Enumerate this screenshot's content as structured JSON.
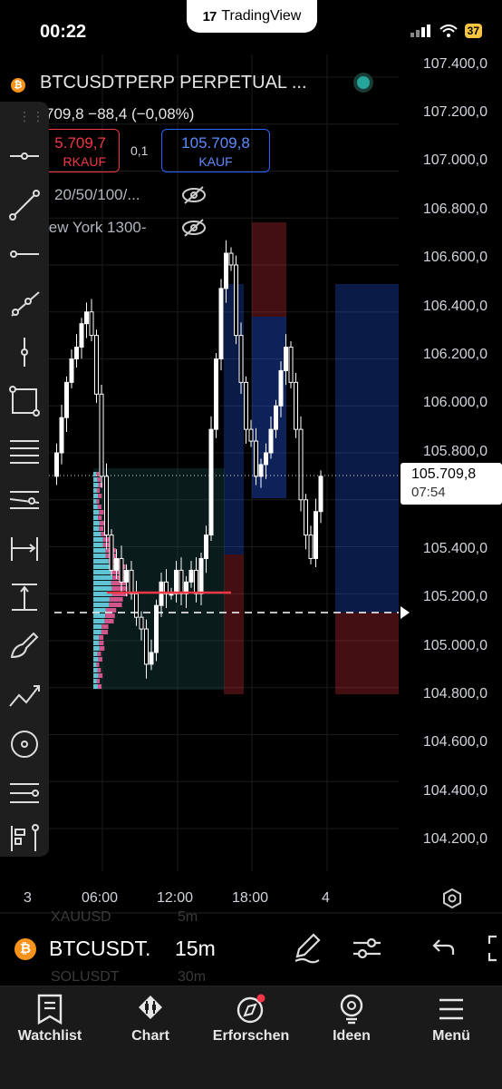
{
  "status_bar": {
    "time": "00:22",
    "brand": "TradingView",
    "battery": "37"
  },
  "header": {
    "symbol_title": "BTCUSDTPERP PERPETUAL ...",
    "quote_line": "709,8  −88,4 (−0,08%)",
    "sell": {
      "price": "5.709,7",
      "label": "RKAUF"
    },
    "spread": "0,1",
    "buy": {
      "price": "105.709,8",
      "label": "KAUF"
    },
    "indicator_1": "20/50/100/...",
    "indicator_2": "lew York 1300-"
  },
  "price_axis": [
    "107.400,0",
    "107.200,0",
    "107.000,0",
    "106.800,0",
    "106.600,0",
    "106.400,0",
    "106.200,0",
    "106.000,0",
    "105.800,0",
    "105.400,0",
    "105.200,0",
    "105.000,0",
    "104.800,0",
    "104.600,0",
    "104.400,0",
    "104.200,0"
  ],
  "current_price": {
    "value": "105.709,8",
    "countdown": "07:54"
  },
  "time_axis": [
    "3",
    "06:00",
    "12:00",
    "18:00",
    "4"
  ],
  "symbol_bar": {
    "symbol": "BTCUSDT.",
    "interval": "15m",
    "ghost_above": "XAUUSD",
    "ghost_above_interval": "5m",
    "ghost_below": "SOLUSDT",
    "ghost_below_interval": "30m"
  },
  "nav": [
    "Watchlist",
    "Chart",
    "Erforschen",
    "Ideen",
    "Menü"
  ],
  "colors": {
    "up": "#ffffff",
    "down": "#ffffff",
    "accent": "#2962ff",
    "sell": "#f23645",
    "live": "#26a69a"
  },
  "icons": [
    "btc-icon",
    "eye-off-icon",
    "pencil-icon",
    "sliders-icon",
    "undo-icon",
    "settings-icon"
  ],
  "chart_data": {
    "type": "candlestick",
    "ylim": [
      104150,
      107450
    ],
    "current_price": 105709.8,
    "dashed_level": 105150,
    "close_path": [
      105700,
      105800,
      105950,
      106100,
      106200,
      106250,
      106350,
      106400,
      106300,
      106050,
      105700,
      105450,
      105300,
      105350,
      105250,
      105300,
      105200,
      105100,
      105050,
      104900,
      104950,
      105150,
      105250,
      105200,
      105200,
      105300,
      105200,
      105250,
      105300,
      105200,
      105350,
      105450,
      105900,
      106200,
      106500,
      106650,
      106600,
      106300,
      106100,
      105900,
      105850,
      105700,
      105750,
      105800,
      105900,
      106000,
      106150,
      106250,
      106100,
      105900,
      105600,
      105450,
      105350,
      105550,
      105700
    ]
  }
}
